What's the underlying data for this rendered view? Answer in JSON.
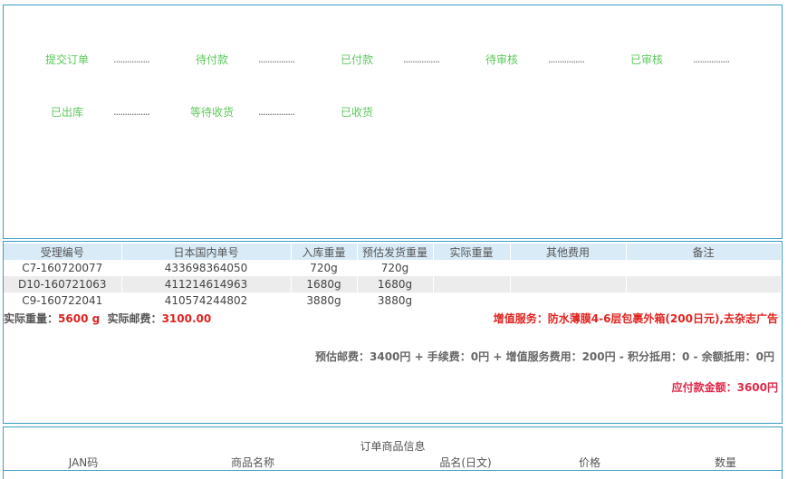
{
  "status_steps": {
    "row1": [
      "提交订单",
      "待付款",
      "已付款",
      "待审核",
      "已审核"
    ],
    "row2": [
      "已出库",
      "等待收货",
      "已收货"
    ],
    "separator": "................"
  },
  "tracking_table": {
    "headers": [
      "受理编号",
      "日本国内单号",
      "入库重量",
      "预估发货重量",
      "实际重量",
      "其他费用",
      "备注"
    ],
    "rows": [
      [
        "C7-160720077",
        "433698364050",
        "720g",
        "720g",
        "",
        "",
        ""
      ],
      [
        "D10-160721063",
        "411214614963",
        "1680g",
        "1680g",
        "",
        "",
        ""
      ],
      [
        "C9-160722041",
        "410574244802",
        "3880g",
        "3880g",
        "",
        "",
        ""
      ]
    ]
  },
  "summary": {
    "actual_weight_label": "实际重量：",
    "actual_weight_value": "5600 g",
    "actual_postage_label": "实际邮费：",
    "actual_postage_value": "3100.00",
    "value_added_service": "增值服务：防水薄膜4-6层包裹外箱(200日元),去杂志广告",
    "estimated_postage": "预估邮费：3400円 + 手续费：0円 + 增值服务费用：200円 - 积分抵用：0 - 余额抵用：0円",
    "amount_due": "应付款金额：3600円"
  },
  "products": {
    "title": "订单商品信息",
    "headers": [
      "JAN码",
      "商品名称",
      "品名(日文)",
      "价格",
      "数量"
    ]
  },
  "colors": {
    "border": "#3a9fc6",
    "status_green": "#5cc85c",
    "header_bg": "#d8ebf7",
    "alert_red": "#e0231f",
    "amount_red": "#e02a4a"
  }
}
